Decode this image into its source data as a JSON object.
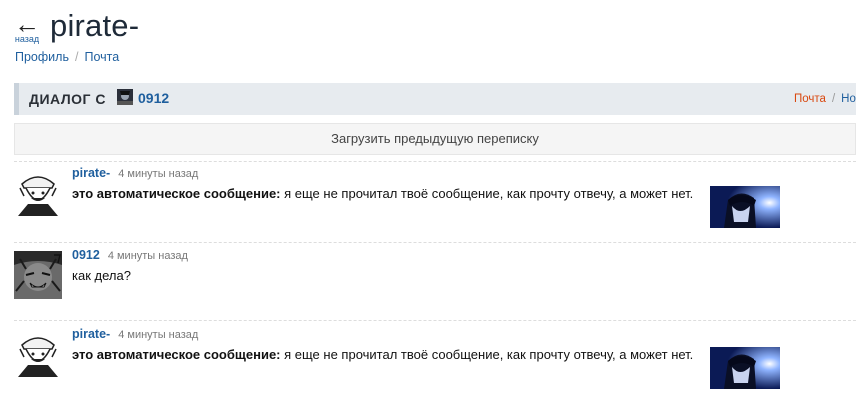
{
  "header": {
    "back_label": "назад",
    "title": "pirate-"
  },
  "breadcrumb": {
    "items": [
      "Профиль",
      "Почта"
    ],
    "separator": "/"
  },
  "dialog": {
    "title": "ДИАЛОГ С",
    "user": "0912",
    "links": [
      "Почта",
      "Но"
    ],
    "separator": "/"
  },
  "load_previous": "Загрузить предыдущую переписку",
  "messages": [
    {
      "author": "pirate-",
      "time": "4 минуты назад",
      "prefix": "это автоматическое сообщение:",
      "text": " я еще не прочитал твоё сообщение, как прочту отвечу, а может нет."
    },
    {
      "author": "0912",
      "time": "4 минуты назад",
      "prefix": "",
      "text": "как дела?"
    },
    {
      "author": "pirate-",
      "time": "4 минуты назад",
      "prefix": "это автоматическое сообщение:",
      "text": " я еще не прочитал твоё сообщение, как прочту отвечу, а может нет."
    }
  ],
  "colors": {
    "link": "#1f5f9e",
    "accent_orange": "#d9480f",
    "header_bg": "#e7ebef"
  }
}
